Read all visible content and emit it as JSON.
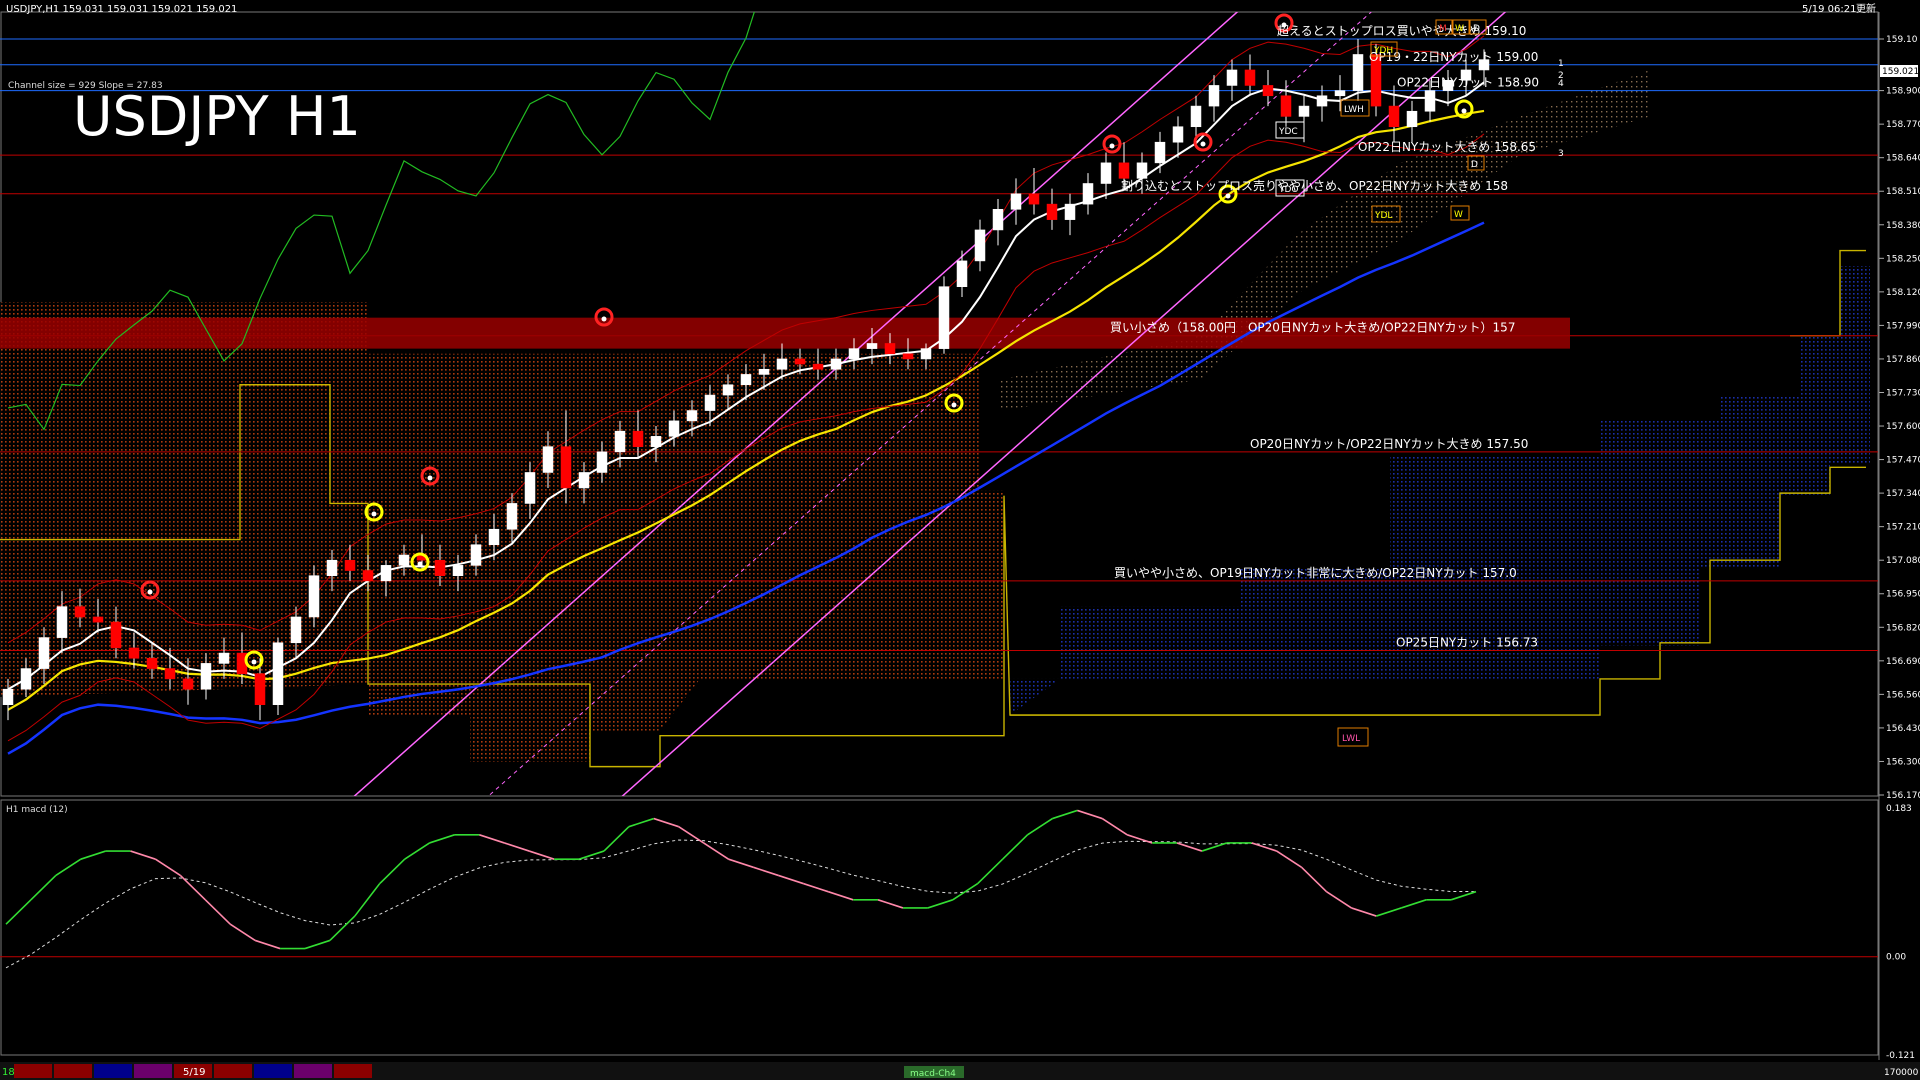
{
  "header": {
    "info": "USDJPY,H1  159.031 159.031 159.021 159.021",
    "datetime": "5/19 06:21",
    "datetime_suffix": "更新"
  },
  "overlay": {
    "channel_info": "Channel size = 929  Slope = 27.83",
    "big_title": "USDJPY H1"
  },
  "macd_panel": {
    "title": "H1  macd (12)",
    "bottom_tab": "macd-Ch4"
  },
  "bottom_bar": {
    "left_date": "18",
    "date_label": "5/19",
    "right_value": "170000",
    "segment_colors": [
      "#8b0000",
      "#8b0000",
      "#00008b",
      "#6b006b",
      "#8b0000",
      "#8b0000",
      "#00008b",
      "#6b006b",
      "#8b0000"
    ]
  },
  "markers": {
    "ydh": "YDH",
    "ydc": "YDC",
    "ydo": "YDO",
    "ydl": "YDL",
    "lwh": "LWH",
    "lwl": "LWL",
    "m": "M",
    "w": "W",
    "d": "D",
    "d2": "D",
    "w2": "W",
    "level_1": "1",
    "level_2": "2",
    "level_3": "3",
    "level_4": "4"
  },
  "colors": {
    "background": "#000000",
    "level_line": "#c00000",
    "blue_line": "#1e6cff",
    "channel": "#ff66ff",
    "ma_white": "#ffffff",
    "ma_yellow": "#f5e400",
    "ma_blue": "#1434ff",
    "chikou": "#22bb22",
    "cloud_red": "#c04010",
    "cloud_blue": "#1a2fa8",
    "macd_up": "#33dd33",
    "macd_down": "#ff88aa"
  },
  "chart_data": {
    "type": "candlestick",
    "symbol": "USDJPY",
    "timeframe": "H1",
    "price_axis": {
      "ticks": [
        "159.10",
        "158.900",
        "158.770",
        "158.640",
        "158.510",
        "158.380",
        "158.250",
        "158.120",
        "157.990",
        "157.860",
        "157.730",
        "157.600",
        "157.470",
        "157.340",
        "157.210",
        "157.080",
        "156.950",
        "156.820",
        "156.690",
        "156.560",
        "156.430",
        "156.300",
        "156.170"
      ],
      "ylim": [
        156.17,
        159.15
      ]
    },
    "current_price": "159.021",
    "macd_axis": {
      "ticks": [
        "0.183",
        "0.00",
        "-0.121"
      ],
      "ylim": [
        -0.121,
        0.183
      ]
    },
    "level_annotations": [
      {
        "label": "超えるとストップロス買いやや大きめ 159.10",
        "price": 159.1
      },
      {
        "label": "OP19・22日NYカット 159.00",
        "price": 159.0
      },
      {
        "label": "OP22日NYカット 158.90",
        "price": 158.9
      },
      {
        "label": "OP22日NYカット大きめ 158.65",
        "price": 158.65
      },
      {
        "label": "割り込むとストップロス売りやや小さめ、OP22日NYカット大きめ 158",
        "price": 158.5
      },
      {
        "label": "買い小さめ（158.00円　OP20日NYカット大きめ/OP22日NYカット）157",
        "price": 157.95
      },
      {
        "label": "OP20日NYカット/OP22日NYカット大きめ 157.50",
        "price": 157.5
      },
      {
        "label": "買いやや小さめ、OP19日NYカット非常に大きめ/OP22日NYカット 157.0",
        "price": 157.0
      },
      {
        "label": "OP25日NYカット 156.73",
        "price": 156.73
      }
    ],
    "candles": [
      [
        156.52,
        156.62,
        156.46,
        156.58
      ],
      [
        156.58,
        156.7,
        156.55,
        156.66
      ],
      [
        156.66,
        156.82,
        156.6,
        156.78
      ],
      [
        156.78,
        156.96,
        156.72,
        156.9
      ],
      [
        156.9,
        156.97,
        156.82,
        156.86
      ],
      [
        156.86,
        156.93,
        156.8,
        156.84
      ],
      [
        156.84,
        156.9,
        156.7,
        156.74
      ],
      [
        156.74,
        156.8,
        156.66,
        156.7
      ],
      [
        156.7,
        156.76,
        156.62,
        156.66
      ],
      [
        156.66,
        156.74,
        156.58,
        156.62
      ],
      [
        156.62,
        156.7,
        156.52,
        156.58
      ],
      [
        156.58,
        156.72,
        156.54,
        156.68
      ],
      [
        156.68,
        156.78,
        156.62,
        156.72
      ],
      [
        156.72,
        156.8,
        156.6,
        156.64
      ],
      [
        156.64,
        156.7,
        156.46,
        156.52
      ],
      [
        156.52,
        156.78,
        156.48,
        156.76
      ],
      [
        156.76,
        156.9,
        156.7,
        156.86
      ],
      [
        156.86,
        157.06,
        156.82,
        157.02
      ],
      [
        157.02,
        157.12,
        156.96,
        157.08
      ],
      [
        157.08,
        157.14,
        157.0,
        157.04
      ],
      [
        157.04,
        157.1,
        156.96,
        157.0
      ],
      [
        157.0,
        157.08,
        156.94,
        157.06
      ],
      [
        157.06,
        157.14,
        157.02,
        157.1
      ],
      [
        157.1,
        157.18,
        157.04,
        157.08
      ],
      [
        157.08,
        157.14,
        156.98,
        157.02
      ],
      [
        157.02,
        157.1,
        156.96,
        157.06
      ],
      [
        157.06,
        157.18,
        157.02,
        157.14
      ],
      [
        157.14,
        157.26,
        157.08,
        157.2
      ],
      [
        157.2,
        157.34,
        157.14,
        157.3
      ],
      [
        157.3,
        157.46,
        157.24,
        157.42
      ],
      [
        157.42,
        157.58,
        157.36,
        157.52
      ],
      [
        157.52,
        157.66,
        157.3,
        157.36
      ],
      [
        157.36,
        157.46,
        157.3,
        157.42
      ],
      [
        157.42,
        157.54,
        157.38,
        157.5
      ],
      [
        157.5,
        157.62,
        157.44,
        157.58
      ],
      [
        157.58,
        157.66,
        157.48,
        157.52
      ],
      [
        157.52,
        157.6,
        157.46,
        157.56
      ],
      [
        157.56,
        157.66,
        157.52,
        157.62
      ],
      [
        157.62,
        157.7,
        157.56,
        157.66
      ],
      [
        157.66,
        157.76,
        157.6,
        157.72
      ],
      [
        157.72,
        157.8,
        157.66,
        157.76
      ],
      [
        157.76,
        157.84,
        157.7,
        157.8
      ],
      [
        157.8,
        157.88,
        157.74,
        157.82
      ],
      [
        157.82,
        157.92,
        157.78,
        157.86
      ],
      [
        157.86,
        157.9,
        157.8,
        157.84
      ],
      [
        157.84,
        157.9,
        157.78,
        157.82
      ],
      [
        157.82,
        157.9,
        157.78,
        157.86
      ],
      [
        157.86,
        157.94,
        157.82,
        157.9
      ],
      [
        157.9,
        157.98,
        157.84,
        157.92
      ],
      [
        157.92,
        157.96,
        157.84,
        157.88
      ],
      [
        157.88,
        157.94,
        157.82,
        157.86
      ],
      [
        157.86,
        157.92,
        157.82,
        157.9
      ],
      [
        157.9,
        158.18,
        157.88,
        158.14
      ],
      [
        158.14,
        158.28,
        158.1,
        158.24
      ],
      [
        158.24,
        158.4,
        158.2,
        158.36
      ],
      [
        158.36,
        158.48,
        158.3,
        158.44
      ],
      [
        158.44,
        158.56,
        158.38,
        158.5
      ],
      [
        158.5,
        158.6,
        158.42,
        158.46
      ],
      [
        158.46,
        158.52,
        158.36,
        158.4
      ],
      [
        158.4,
        158.5,
        158.34,
        158.46
      ],
      [
        158.46,
        158.58,
        158.42,
        158.54
      ],
      [
        158.54,
        158.66,
        158.48,
        158.62
      ],
      [
        158.62,
        158.7,
        158.52,
        158.56
      ],
      [
        158.56,
        158.66,
        158.5,
        158.62
      ],
      [
        158.62,
        158.74,
        158.58,
        158.7
      ],
      [
        158.7,
        158.8,
        158.64,
        158.76
      ],
      [
        158.76,
        158.88,
        158.7,
        158.84
      ],
      [
        158.84,
        158.96,
        158.78,
        158.92
      ],
      [
        158.92,
        159.02,
        158.86,
        158.98
      ],
      [
        158.98,
        159.04,
        158.88,
        158.92
      ],
      [
        158.92,
        158.98,
        158.84,
        158.88
      ],
      [
        158.88,
        158.94,
        158.76,
        158.8
      ],
      [
        158.8,
        158.88,
        158.7,
        158.84
      ],
      [
        158.84,
        158.92,
        158.78,
        158.88
      ],
      [
        158.88,
        158.96,
        158.82,
        158.9
      ],
      [
        158.9,
        159.1,
        158.86,
        159.04
      ],
      [
        159.04,
        159.08,
        158.8,
        158.84
      ],
      [
        158.84,
        158.92,
        158.7,
        158.76
      ],
      [
        158.76,
        158.86,
        158.7,
        158.82
      ],
      [
        158.82,
        158.94,
        158.78,
        158.9
      ],
      [
        158.9,
        158.98,
        158.84,
        158.94
      ],
      [
        158.94,
        159.02,
        158.88,
        158.98
      ],
      [
        158.98,
        159.06,
        158.92,
        159.02
      ]
    ],
    "macd": [
      0.04,
      0.07,
      0.1,
      0.12,
      0.13,
      0.13,
      0.12,
      0.1,
      0.07,
      0.04,
      0.02,
      0.01,
      0.01,
      0.02,
      0.05,
      0.09,
      0.12,
      0.14,
      0.15,
      0.15,
      0.14,
      0.13,
      0.12,
      0.12,
      0.13,
      0.16,
      0.17,
      0.16,
      0.14,
      0.12,
      0.11,
      0.1,
      0.09,
      0.08,
      0.07,
      0.07,
      0.06,
      0.06,
      0.07,
      0.09,
      0.12,
      0.15,
      0.17,
      0.18,
      0.17,
      0.15,
      0.14,
      0.14,
      0.13,
      0.14,
      0.14,
      0.13,
      0.11,
      0.08,
      0.06,
      0.05,
      0.06,
      0.07,
      0.07,
      0.08
    ]
  }
}
